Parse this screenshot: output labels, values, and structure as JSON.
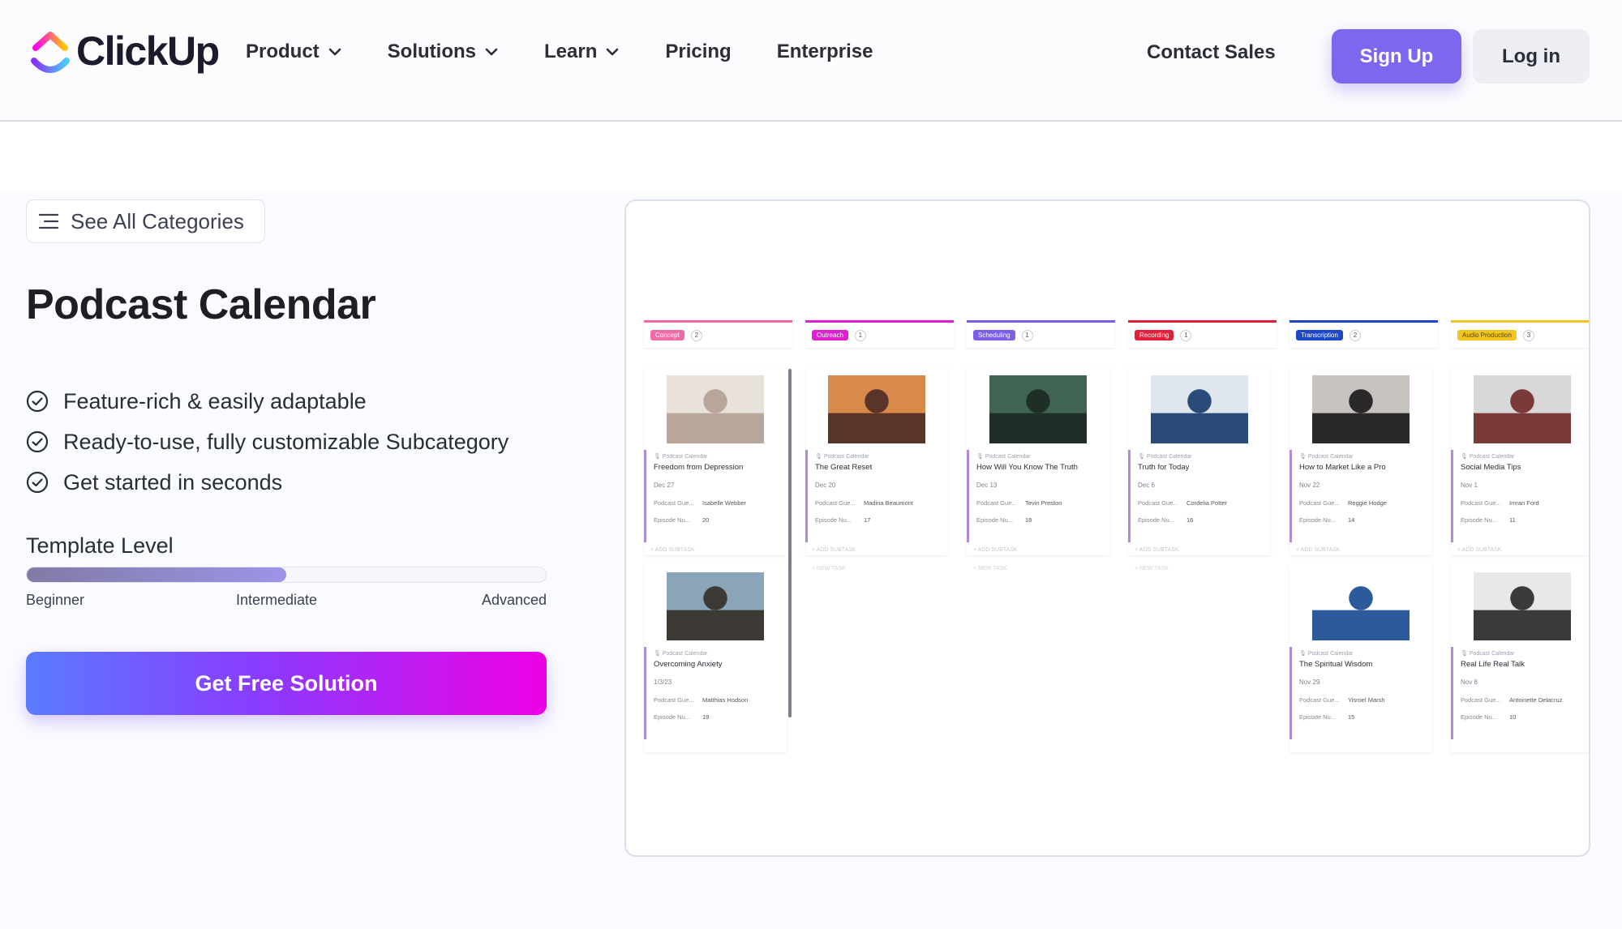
{
  "header": {
    "brand": "ClickUp",
    "nav": [
      {
        "label": "Product",
        "has_dropdown": true
      },
      {
        "label": "Solutions",
        "has_dropdown": true
      },
      {
        "label": "Learn",
        "has_dropdown": true
      },
      {
        "label": "Pricing",
        "has_dropdown": false
      },
      {
        "label": "Enterprise",
        "has_dropdown": false
      }
    ],
    "contact_sales": "Contact Sales",
    "sign_up": "Sign Up",
    "log_in": "Log in"
  },
  "colors": {
    "accent": "#7b68ee",
    "cta_gradient_start": "#5a7bff",
    "cta_gradient_end": "#ee00e4"
  },
  "sidebar": {
    "see_all_categories": "See All Categories",
    "title": "Podcast Calendar",
    "features": [
      "Feature-rich & easily adaptable",
      "Ready-to-use, fully customizable Subcategory",
      "Get started in seconds"
    ],
    "template_level": {
      "label": "Template Level",
      "value_fraction": 0.5,
      "ticks": [
        "Beginner",
        "Intermediate",
        "Advanced"
      ]
    },
    "cta": "Get Free Solution"
  },
  "preview": {
    "columns": [
      {
        "tag": "Concept",
        "color": "#f06aa8",
        "count": "2",
        "cards": [
          {
            "list": "Podcast Calendar",
            "title": "Freedom from Depression",
            "date": "Dec 27",
            "guest_label": "Podcast Gue...",
            "guest": "Isabelle Webber",
            "episode_label": "Episode Nu...",
            "episode": "20"
          },
          {
            "list": "Podcast Calendar",
            "title": "Overcoming Anxiety",
            "date": "1/3/23",
            "guest_label": "Podcast Gue...",
            "guest": "Matthias Hodson",
            "episode_label": "Episode Nu...",
            "episode": "19"
          }
        ]
      },
      {
        "tag": "Outreach",
        "color": "#e01ed2",
        "count": "1",
        "cards": [
          {
            "list": "Podcast Calendar",
            "title": "The Great Reset",
            "date": "Dec 20",
            "guest_label": "Podcast Gue...",
            "guest": "Madina Beaumont",
            "episode_label": "Episode Nu...",
            "episode": "17"
          }
        ]
      },
      {
        "tag": "Scheduling",
        "color": "#7b5de8",
        "count": "1",
        "cards": [
          {
            "list": "Podcast Calendar",
            "title": "How Will You Know The Truth",
            "date": "Dec 13",
            "guest_label": "Podcast Gue...",
            "guest": "Tevin Preston",
            "episode_label": "Episode Nu...",
            "episode": "18"
          }
        ]
      },
      {
        "tag": "Recording",
        "color": "#e2203a",
        "count": "1",
        "cards": [
          {
            "list": "Podcast Calendar",
            "title": "Truth for Today",
            "date": "Dec 6",
            "guest_label": "Podcast Gue...",
            "guest": "Cordelia Potter",
            "episode_label": "Episode Nu...",
            "episode": "16"
          }
        ]
      },
      {
        "tag": "Transcription",
        "color": "#1c48c8",
        "count": "2",
        "cards": [
          {
            "list": "Podcast Calendar",
            "title": "How to Market Like a Pro",
            "date": "Nov 22",
            "guest_label": "Podcast Gue...",
            "guest": "Reggie Hodge",
            "episode_label": "Episode Nu...",
            "episode": "14"
          },
          {
            "list": "Podcast Calendar",
            "title": "The Spiritual Wisdom",
            "date": "Nov 29",
            "guest_label": "Podcast Gue...",
            "guest": "Yisroel Marsh",
            "episode_label": "Episode Nu...",
            "episode": "15"
          }
        ]
      },
      {
        "tag": "Audio Production",
        "color": "#f2c51f",
        "count": "3",
        "cards": [
          {
            "list": "Podcast Calendar",
            "title": "Social Media Tips",
            "date": "Nov 1",
            "guest_label": "Podcast Gue...",
            "guest": "Imran Ford",
            "episode_label": "Episode Nu...",
            "episode": "11"
          },
          {
            "list": "Podcast Calendar",
            "title": "Real Life Real Talk",
            "date": "Nov 8",
            "guest_label": "Podcast Gue...",
            "guest": "Antoinette Delacruz",
            "episode_label": "Episode Nu...",
            "episode": "10"
          }
        ]
      }
    ],
    "add_subtask": "+ ADD SUBTASK",
    "new_task": "+ NEW TASK"
  }
}
